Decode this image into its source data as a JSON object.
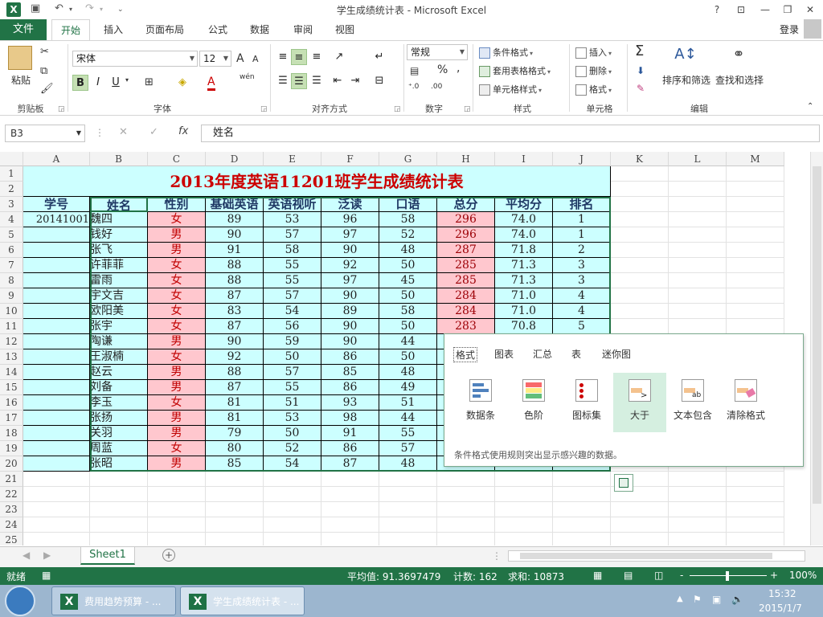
{
  "window": {
    "title": "学生成绩统计表 - Microsoft Excel",
    "help": "?",
    "app_icon": "X"
  },
  "tabs": {
    "file": "文件",
    "items": [
      "开始",
      "插入",
      "页面布局",
      "公式",
      "数据",
      "审阅",
      "视图"
    ],
    "login": "登录"
  },
  "ribbon": {
    "clipboard": {
      "paste": "粘贴",
      "label": "剪贴板"
    },
    "font": {
      "name": "宋体",
      "size": "12",
      "bold": "B",
      "italic": "I",
      "underline": "U",
      "label": "字体",
      "pinyin": "wén",
      "grow": "A",
      "shrink": "A",
      "color": "A"
    },
    "align": {
      "label": "对齐方式"
    },
    "number": {
      "format": "常规",
      "percent": "%",
      "comma": ",",
      "label": "数字"
    },
    "styles": {
      "cond": "条件格式",
      "table": "套用表格格式",
      "cell": "单元格样式",
      "label": "样式"
    },
    "cells": {
      "insert": "插入",
      "delete": "删除",
      "format": "格式",
      "label": "单元格"
    },
    "edit": {
      "sum": "Σ",
      "sort": "排序和筛选",
      "find": "查找和选择",
      "label": "编辑"
    }
  },
  "formula_bar": {
    "name_box": "B3",
    "fx": "fx",
    "value": "姓名"
  },
  "sheet": {
    "columns": [
      "A",
      "B",
      "C",
      "D",
      "E",
      "F",
      "G",
      "H",
      "I",
      "J",
      "K",
      "L",
      "M"
    ],
    "row_numbers": [
      "1",
      "2",
      "3",
      "4",
      "5",
      "6",
      "7",
      "8",
      "9",
      "10",
      "11",
      "12",
      "13",
      "14",
      "15",
      "16",
      "17",
      "18",
      "19",
      "20",
      "21",
      "22",
      "23",
      "24",
      "25"
    ],
    "title": "2013年度英语11201班学生成绩统计表",
    "headers": [
      "学号",
      "姓名",
      "性别",
      "基础英语",
      "英语视听",
      "泛读",
      "口语",
      "总分",
      "平均分",
      "排名"
    ],
    "rows": [
      [
        "20141001",
        "魏四",
        "女",
        "89",
        "53",
        "96",
        "58",
        "296",
        "74.0",
        "1"
      ],
      [
        "",
        "钱好",
        "男",
        "90",
        "57",
        "97",
        "52",
        "296",
        "74.0",
        "1"
      ],
      [
        "",
        "张飞",
        "男",
        "91",
        "58",
        "90",
        "48",
        "287",
        "71.8",
        "2"
      ],
      [
        "",
        "许菲菲",
        "女",
        "88",
        "55",
        "92",
        "50",
        "285",
        "71.3",
        "3"
      ],
      [
        "",
        "雷雨",
        "女",
        "88",
        "55",
        "97",
        "45",
        "285",
        "71.3",
        "3"
      ],
      [
        "",
        "宇文吉",
        "女",
        "87",
        "57",
        "90",
        "50",
        "284",
        "71.0",
        "4"
      ],
      [
        "",
        "欧阳美",
        "女",
        "83",
        "54",
        "89",
        "58",
        "284",
        "71.0",
        "4"
      ],
      [
        "",
        "张宇",
        "女",
        "87",
        "56",
        "90",
        "50",
        "283",
        "70.8",
        "5"
      ],
      [
        "",
        "陶谦",
        "男",
        "90",
        "59",
        "90",
        "44",
        "",
        "",
        ""
      ],
      [
        "",
        "王淑楠",
        "女",
        "92",
        "50",
        "86",
        "50",
        "",
        "",
        ""
      ],
      [
        "",
        "赵云",
        "男",
        "88",
        "57",
        "85",
        "48",
        "",
        "",
        ""
      ],
      [
        "",
        "刘备",
        "男",
        "87",
        "55",
        "86",
        "49",
        "",
        "",
        ""
      ],
      [
        "",
        "李玉",
        "女",
        "81",
        "51",
        "93",
        "51",
        "",
        "",
        ""
      ],
      [
        "",
        "张扬",
        "男",
        "81",
        "53",
        "98",
        "44",
        "",
        "",
        ""
      ],
      [
        "",
        "关羽",
        "男",
        "79",
        "50",
        "91",
        "55",
        "",
        "",
        ""
      ],
      [
        "",
        "周蓝",
        "女",
        "80",
        "52",
        "86",
        "57",
        "",
        "",
        ""
      ],
      [
        "",
        "张昭",
        "男",
        "85",
        "54",
        "87",
        "48",
        "",
        "",
        ""
      ]
    ],
    "tab": "Sheet1"
  },
  "quick_analysis": {
    "tabs": [
      "格式",
      "图表",
      "汇总",
      "表",
      "迷你图"
    ],
    "items": [
      {
        "label": "数据条",
        "icon": "data-bar-icon"
      },
      {
        "label": "色阶",
        "icon": "color-scale-icon"
      },
      {
        "label": "图标集",
        "icon": "icon-set-icon"
      },
      {
        "label": "大于",
        "icon": "greater-than-icon"
      },
      {
        "label": "文本包含",
        "icon": "text-contains-icon"
      },
      {
        "label": "清除格式",
        "icon": "clear-format-icon"
      }
    ],
    "description": "条件格式使用规则突出显示感兴趣的数据。"
  },
  "status": {
    "ready": "就绪",
    "average": "平均值: 91.3697479",
    "count": "计数: 162",
    "sum": "求和: 10873",
    "zoom": "100%",
    "minus": "-",
    "plus": "+"
  },
  "taskbar": {
    "items": [
      "费用趋势预算 - ...",
      "学生成绩统计表 - ..."
    ],
    "time": "15:32",
    "date": "2015/1/7"
  },
  "colors": {
    "brand": "#217346",
    "table_bg": "#ccffff",
    "pink": "#ffc7ce",
    "title_red": "#cc0000",
    "header_blue": "#1f3864"
  }
}
